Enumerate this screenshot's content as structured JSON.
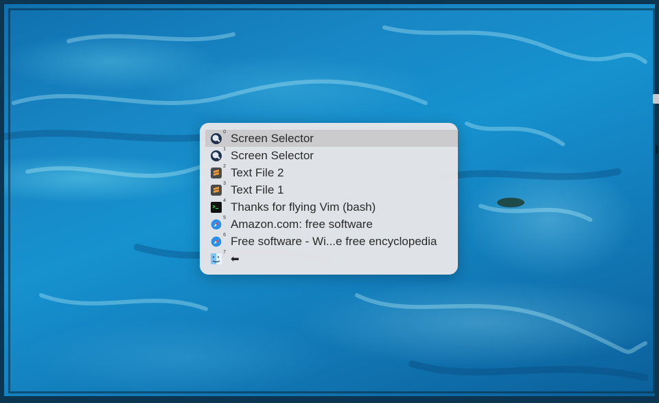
{
  "switcher": {
    "items": [
      {
        "index": "0",
        "icon": "quicktime-icon",
        "label": "Screen Selector",
        "selected": true
      },
      {
        "index": "1",
        "icon": "quicktime-icon",
        "label": "Screen Selector",
        "selected": false
      },
      {
        "index": "2",
        "icon": "sublime-text-icon",
        "label": "Text File 2",
        "selected": false
      },
      {
        "index": "3",
        "icon": "sublime-text-icon",
        "label": "Text File 1",
        "selected": false
      },
      {
        "index": "4",
        "icon": "terminal-icon",
        "label": "Thanks for flying Vim (bash)",
        "selected": false
      },
      {
        "index": "5",
        "icon": "safari-icon",
        "label": "Amazon.com: free software",
        "selected": false
      },
      {
        "index": "6",
        "icon": "safari-icon",
        "label": "Free software - Wi...e free encyclopedia",
        "selected": false
      },
      {
        "index": "7",
        "icon": "finder-icon",
        "label": "⬅",
        "selected": false
      }
    ]
  }
}
